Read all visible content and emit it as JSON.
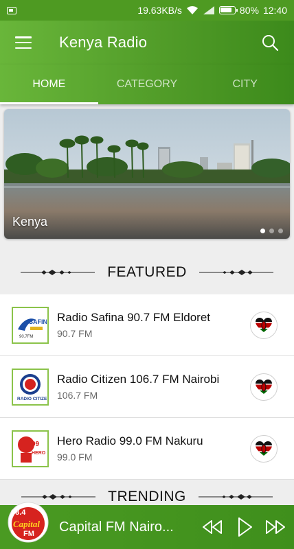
{
  "status_bar": {
    "network_speed": "19.63KB/s",
    "battery": "80%",
    "time": "12:40"
  },
  "app_bar": {
    "title": "Kenya Radio"
  },
  "tabs": [
    {
      "label": "HOME",
      "active": true
    },
    {
      "label": "CATEGORY",
      "active": false
    },
    {
      "label": "CITY",
      "active": false
    }
  ],
  "banner": {
    "caption": "Kenya",
    "slide_count": 3,
    "active_slide": 1
  },
  "sections": {
    "featured": "FEATURED",
    "trending": "TRENDING"
  },
  "stations": [
    {
      "name": "Radio Safina 90.7 FM Eldoret",
      "frequency": "90.7 FM",
      "logo": "radio-safina-logo"
    },
    {
      "name": "Radio Citizen 106.7 FM Nairobi",
      "frequency": "106.7 FM",
      "logo": "radio-citizen-logo"
    },
    {
      "name": "Hero Radio 99.0 FM Nakuru",
      "frequency": "99.0 FM",
      "logo": "hero-radio-logo"
    }
  ],
  "player": {
    "now_playing": "Capital FM Nairo...",
    "logo": "capital-fm-logo"
  },
  "colors": {
    "primary": "#4f9a27",
    "accent_light": "#69b63a",
    "kenya_red": "#bb0000",
    "kenya_green": "#006600"
  }
}
